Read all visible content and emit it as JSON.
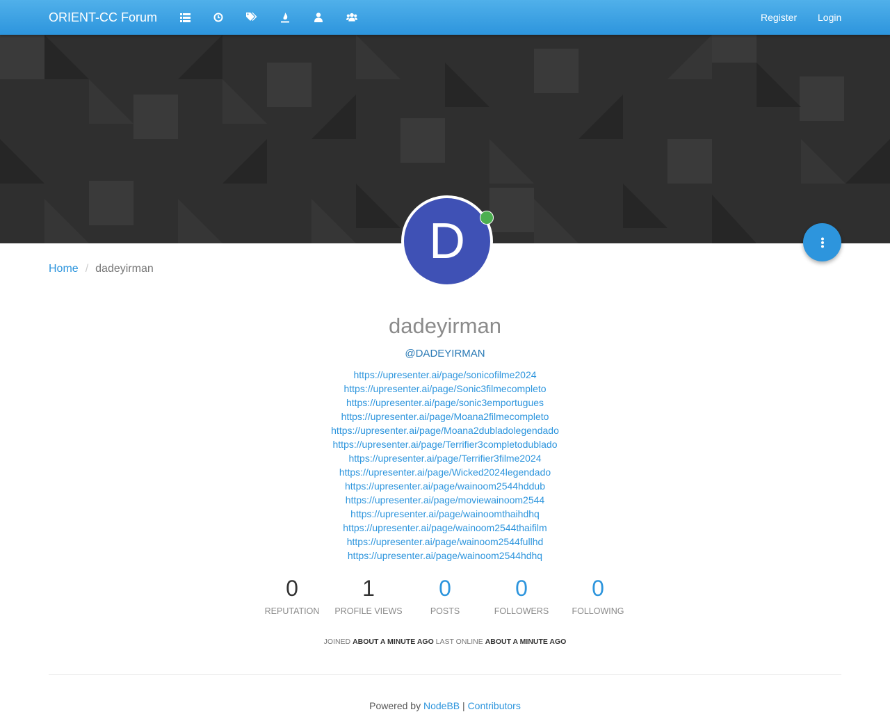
{
  "navbar": {
    "brand": "ORIENT-CC Forum",
    "icons": [
      "list-icon",
      "clock-icon",
      "tags-icon",
      "fire-icon",
      "user-icon",
      "users-icon"
    ],
    "register": "Register",
    "login": "Login"
  },
  "breadcrumb": {
    "home": "Home",
    "separator": "/",
    "current": "dadeyirman"
  },
  "avatar": {
    "letter": "D",
    "color": "#3f51b5",
    "status_color": "#4caf50"
  },
  "profile": {
    "fullname": "dadeyirman",
    "username": "@DADEYIRMAN",
    "about_links": [
      "https://upresenter.ai/page/sonicofilme2024",
      "https://upresenter.ai/page/Sonic3filmecompleto",
      "https://upresenter.ai/page/sonic3emportugues",
      "https://upresenter.ai/page/Moana2filmecompleto",
      "https://upresenter.ai/page/Moana2dubladolegendado",
      "https://upresenter.ai/page/Terrifier3completodublado",
      "https://upresenter.ai/page/Terrifier3filme2024",
      "https://upresenter.ai/page/Wicked2024legendado",
      "https://upresenter.ai/page/wainoom2544hddub",
      "https://upresenter.ai/page/moviewainoom2544",
      "https://upresenter.ai/page/wainoomthaihdhq",
      "https://upresenter.ai/page/wainoom2544thaifilm",
      "https://upresenter.ai/page/wainoom2544fullhd",
      "https://upresenter.ai/page/wainoom2544hdhq"
    ]
  },
  "stats": [
    {
      "value": "0",
      "label": "REPUTATION",
      "link": false
    },
    {
      "value": "1",
      "label": "PROFILE VIEWS",
      "link": false
    },
    {
      "value": "0",
      "label": "POSTS",
      "link": true
    },
    {
      "value": "0",
      "label": "FOLLOWERS",
      "link": true
    },
    {
      "value": "0",
      "label": "FOLLOWING",
      "link": true
    }
  ],
  "activity": {
    "joined_label": "JOINED",
    "joined_value": "ABOUT A MINUTE AGO",
    "online_label": "LAST ONLINE",
    "online_value": "ABOUT A MINUTE AGO"
  },
  "footer": {
    "prefix": "Powered by",
    "nodebb": "NodeBB",
    "sep": "|",
    "contributors": "Contributors"
  },
  "colors": {
    "accent": "#2d95dd",
    "navbar": "#3ba3e5",
    "cover": "#2f2f2f"
  }
}
